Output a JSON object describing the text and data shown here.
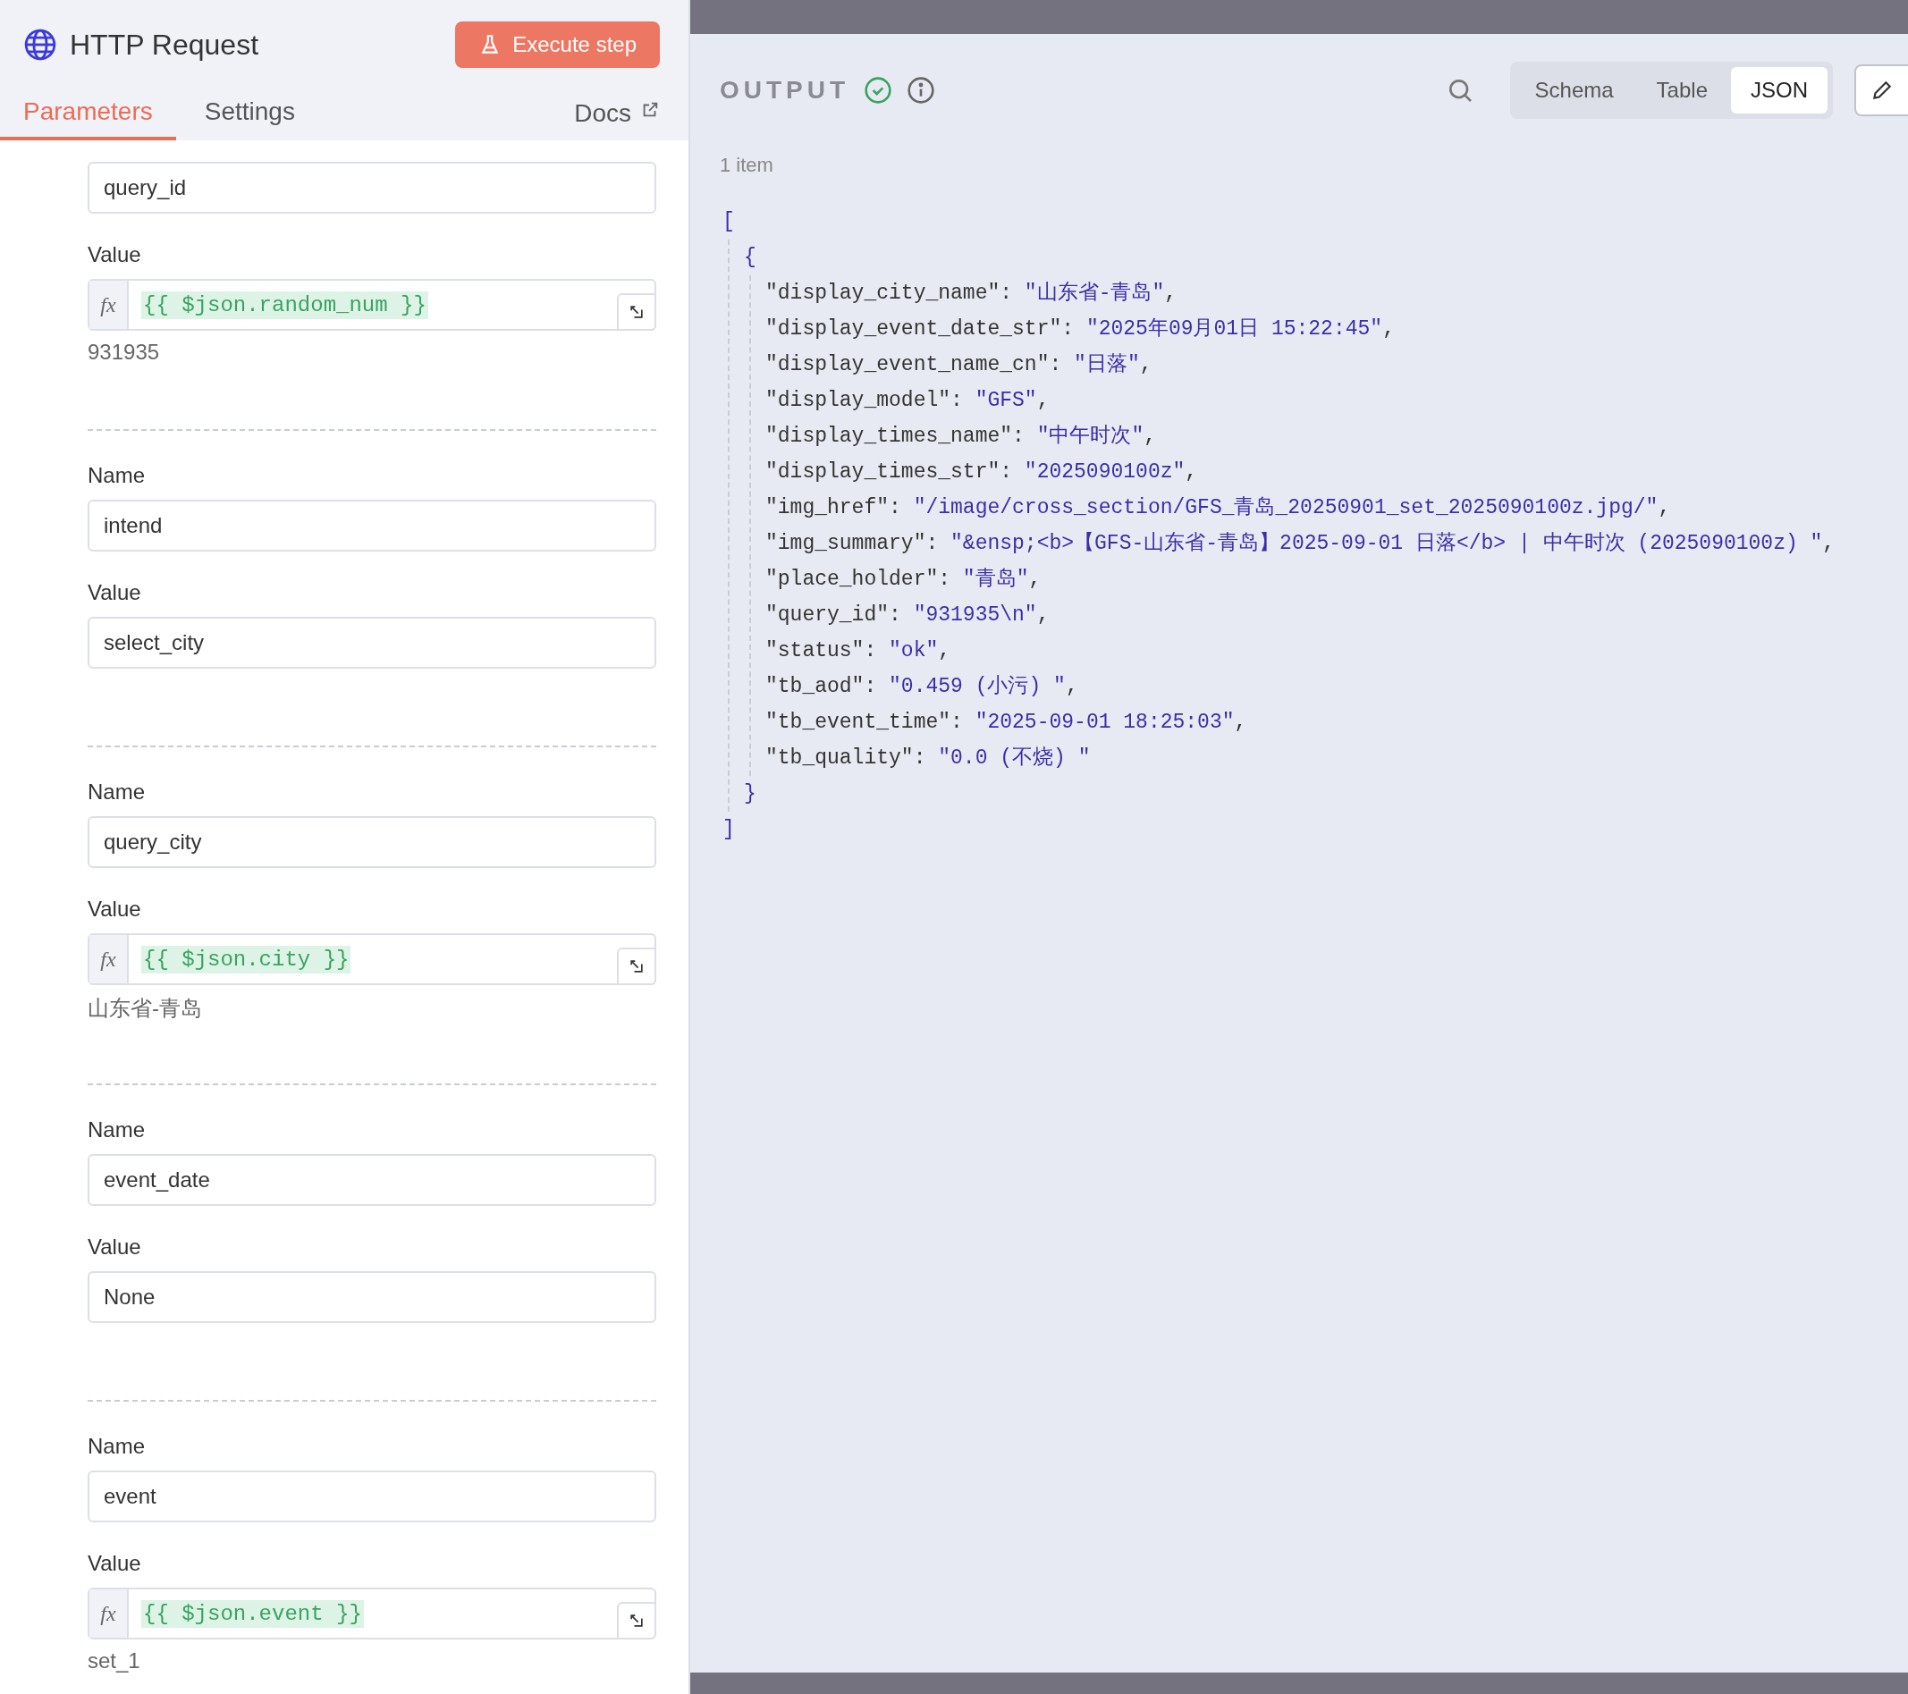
{
  "node": {
    "title": "HTTP Request",
    "execute_button": "Execute step"
  },
  "tabs": [
    {
      "label": "Parameters",
      "selected": true
    },
    {
      "label": "Settings",
      "selected": false
    }
  ],
  "docs_link": "Docs",
  "parameters": [
    {
      "name": "query_id",
      "value_label": "Value",
      "kind": "expression",
      "fx_label": "fx",
      "value": "{{ $json.random_num }}",
      "result": "931935"
    },
    {
      "name_label": "Name",
      "name": "intend",
      "value_label": "Value",
      "kind": "plain",
      "value": "select_city"
    },
    {
      "name_label": "Name",
      "name": "query_city",
      "value_label": "Value",
      "kind": "expression",
      "fx_label": "fx",
      "value": "{{ $json.city }}",
      "result": "山东省-青岛"
    },
    {
      "name_label": "Name",
      "name": "event_date",
      "value_label": "Value",
      "kind": "plain",
      "value": "None"
    },
    {
      "name_label": "Name",
      "name": "event",
      "value_label": "Value",
      "kind": "expression",
      "fx_label": "fx",
      "value": "{{ $json.event }}",
      "result": "set_1"
    }
  ],
  "output": {
    "title": "OUTPUT",
    "success": true,
    "views": [
      {
        "label": "Schema",
        "selected": false
      },
      {
        "label": "Table",
        "selected": false
      },
      {
        "label": "JSON",
        "selected": true
      }
    ],
    "item_count": "1 item",
    "json": {
      "open": "[",
      "close": "]",
      "objects": [
        {
          "open": "{",
          "close": "}",
          "pairs": [
            {
              "key": "\"display_city_name\":",
              "value": "\"山东省-青岛\"",
              "sep": ","
            },
            {
              "key": "\"display_event_date_str\":",
              "value": "\"2025年09月01日 15:22:45\"",
              "sep": ","
            },
            {
              "key": "\"display_event_name_cn\":",
              "value": "\"日落\"",
              "sep": ","
            },
            {
              "key": "\"display_model\":",
              "value": "\"GFS\"",
              "sep": ","
            },
            {
              "key": "\"display_times_name\":",
              "value": "\"中午时次\"",
              "sep": ","
            },
            {
              "key": "\"display_times_str\":",
              "value": "\"2025090100z\"",
              "sep": ","
            },
            {
              "key": "\"img_href\":",
              "value": "\"/image/cross_section/GFS_青岛_20250901_set_2025090100z.jpg/\"",
              "sep": ","
            },
            {
              "key": "\"img_summary\":",
              "value": "\"&ensp;<b>【GFS-山东省-青岛】2025-09-01 日落</b> | 中午时次 (2025090100z) \"",
              "sep": ","
            },
            {
              "key": "\"place_holder\":",
              "value": "\"青岛\"",
              "sep": ","
            },
            {
              "key": "\"query_id\":",
              "value": "\"931935\\n\"",
              "sep": ","
            },
            {
              "key": "\"status\":",
              "value": "\"ok\"",
              "sep": ","
            },
            {
              "key": "\"tb_aod\":",
              "value": "\"0.459 (小污) \"",
              "sep": ","
            },
            {
              "key": "\"tb_event_time\":",
              "value": "\"2025-09-01 18:25:03\"",
              "sep": ","
            },
            {
              "key": "\"tb_quality\":",
              "value": "\"0.0 (不烧) \""
            }
          ]
        }
      ]
    }
  }
}
